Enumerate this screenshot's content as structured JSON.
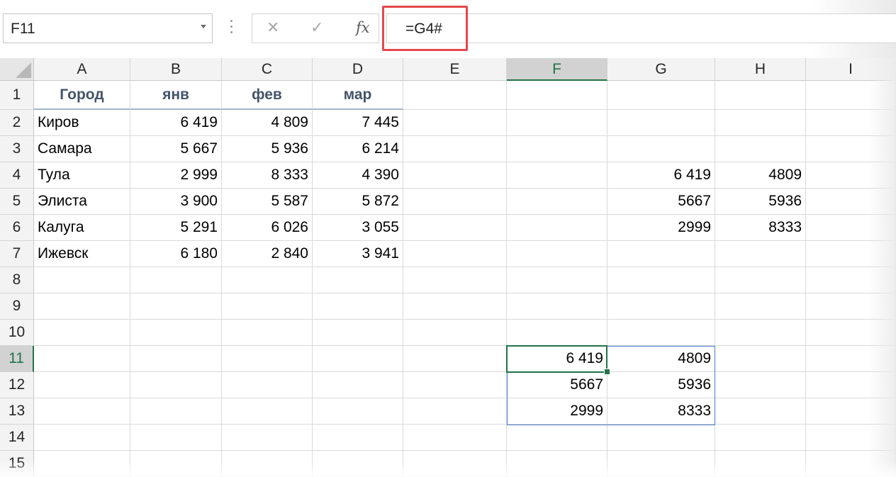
{
  "name_box": {
    "value": "F11"
  },
  "formula_bar": {
    "cancel_icon": "✕",
    "enter_icon": "✓",
    "function_icon": "fx",
    "formula": "=G4#"
  },
  "columns": [
    "A",
    "B",
    "C",
    "D",
    "E",
    "F",
    "G",
    "H",
    "I"
  ],
  "active_column": "F",
  "rows": [
    "1",
    "2",
    "3",
    "4",
    "5",
    "6",
    "7",
    "8",
    "9",
    "10",
    "11",
    "12",
    "13",
    "14",
    "15"
  ],
  "active_row": "11",
  "table": {
    "headers": [
      "Город",
      "янв",
      "фев",
      "мар"
    ],
    "rows": [
      [
        "Киров",
        "6 419",
        "4 809",
        "7 445"
      ],
      [
        "Самара",
        "5 667",
        "5 936",
        "6 214"
      ],
      [
        "Тула",
        "2 999",
        "8 333",
        "4 390"
      ],
      [
        "Элиста",
        "3 900",
        "5 587",
        "5 872"
      ],
      [
        "Калуга",
        "5 291",
        "6 026",
        "3 055"
      ],
      [
        "Ижевск",
        "6 180",
        "2 840",
        "3 941"
      ]
    ]
  },
  "block_g4": [
    [
      "6 419",
      "4809"
    ],
    [
      "5667",
      "5936"
    ],
    [
      "2999",
      "8333"
    ]
  ],
  "spill_f11": [
    [
      "6 419",
      "4809"
    ],
    [
      "5667",
      "5936"
    ],
    [
      "2999",
      "8333"
    ]
  ],
  "colors": {
    "accent": "#217346",
    "header_text": "#44546a",
    "highlight": "#e5484d",
    "spill_border": "#4a7bc8"
  }
}
